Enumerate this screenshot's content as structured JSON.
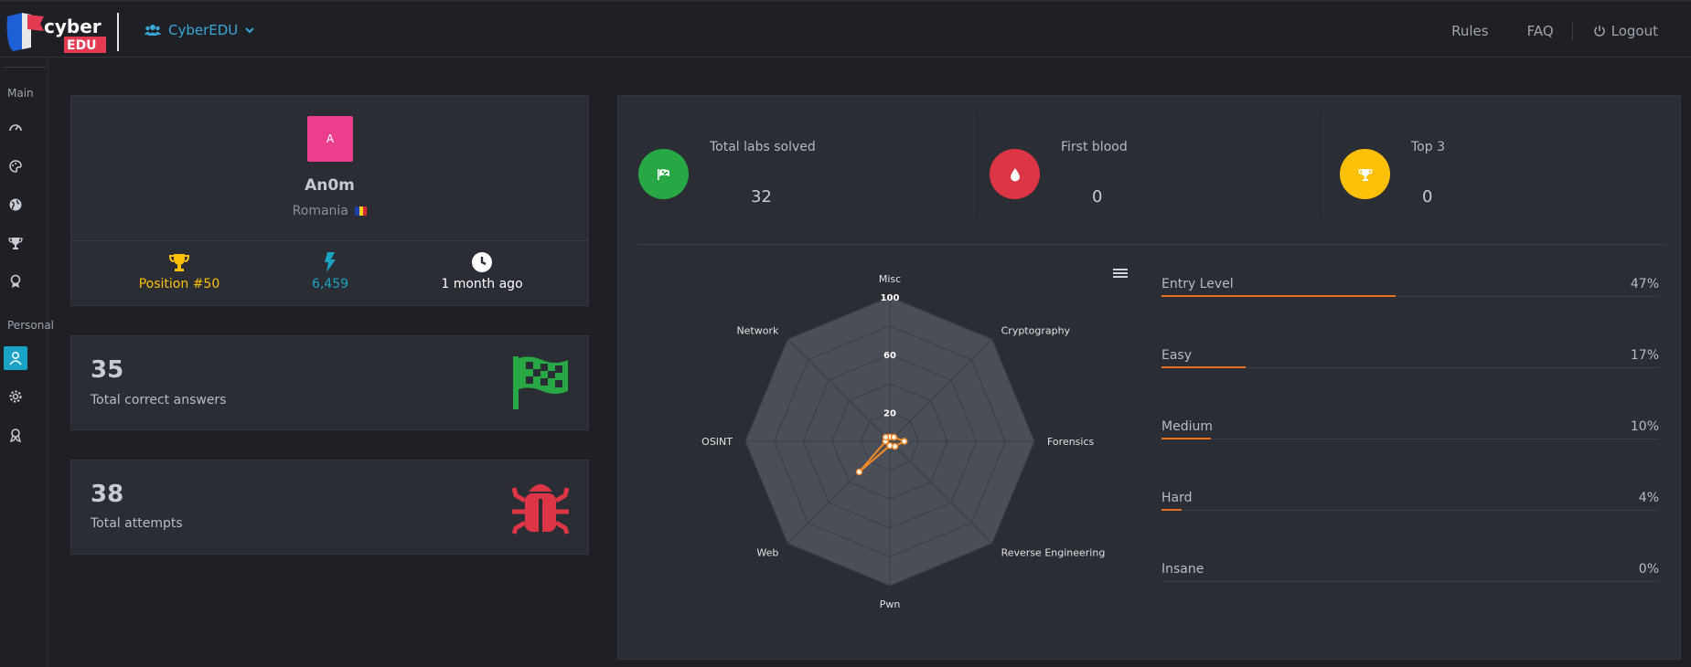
{
  "topbar": {
    "logo_text_top": "cyber",
    "logo_text_bottom": "EDU",
    "org_name": "CyberEDU",
    "links": [
      "Rules",
      "FAQ"
    ],
    "logout_label": "Logout"
  },
  "sidebar": {
    "section_main": "Main",
    "section_personal": "Personal",
    "main_icons": [
      "dashboard-icon",
      "palette-icon",
      "globe-icon",
      "trophy-icon",
      "award-icon"
    ],
    "personal_icons": [
      "user-icon",
      "gear-icon",
      "awards-icon"
    ]
  },
  "profile": {
    "avatar_letter": "A",
    "username": "An0m",
    "country": "Romania",
    "position": "Position #50",
    "points": "6,459",
    "last_seen": "1 month ago"
  },
  "stats": {
    "correct_answers": {
      "value": "35",
      "label": "Total correct answers"
    },
    "attempts": {
      "value": "38",
      "label": "Total attempts"
    }
  },
  "kpis": [
    {
      "label": "Total labs solved",
      "value": "32",
      "color": "#28a745",
      "icon": "flag-icon"
    },
    {
      "label": "First blood",
      "value": "0",
      "color": "#dc3545",
      "icon": "drop-icon"
    },
    {
      "label": "Top 3",
      "value": "0",
      "color": "#ffc107",
      "icon": "trophy-icon"
    }
  ],
  "chart_data": {
    "type": "radar",
    "categories": [
      "Misc",
      "Cryptography",
      "Forensics",
      "Reverse Engineering",
      "Pwn",
      "Web",
      "OSINT",
      "Network"
    ],
    "values": [
      3,
      4,
      10,
      5,
      3,
      30,
      3,
      4
    ],
    "tick_labels": [
      "20",
      "60",
      "100"
    ],
    "ylim": [
      0,
      100
    ],
    "series_color": "#f28a29",
    "grid": true
  },
  "difficulty": [
    {
      "name": "Entry Level",
      "percent": "47%",
      "fraction": 0.47
    },
    {
      "name": "Easy",
      "percent": "17%",
      "fraction": 0.17
    },
    {
      "name": "Medium",
      "percent": "10%",
      "fraction": 0.1
    },
    {
      "name": "Hard",
      "percent": "4%",
      "fraction": 0.04
    },
    {
      "name": "Insane",
      "percent": "0%",
      "fraction": 0.0
    }
  ]
}
